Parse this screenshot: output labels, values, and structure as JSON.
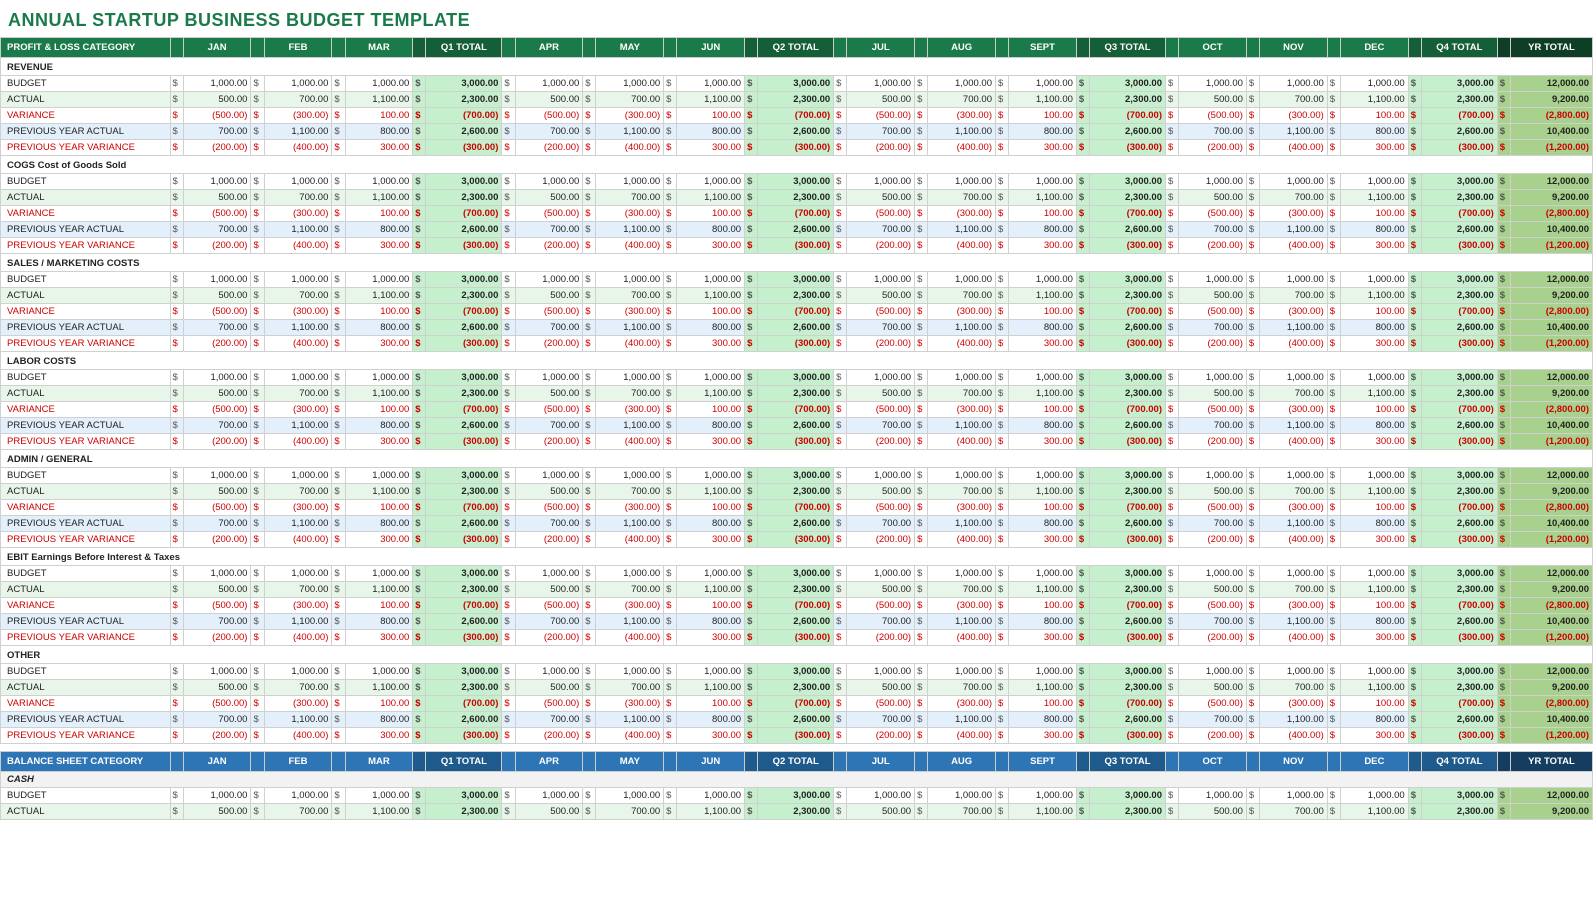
{
  "title": "ANNUAL STARTUP BUSINESS BUDGET TEMPLATE",
  "columns": {
    "label": "PROFIT & LOSS CATEGORY",
    "months": [
      "JAN",
      "FEB",
      "MAR",
      "APR",
      "MAY",
      "JUN",
      "JUL",
      "AUG",
      "SEPT",
      "OCT",
      "NOV",
      "DEC"
    ],
    "q_totals": [
      "Q1 TOTAL",
      "Q2 TOTAL",
      "Q3 TOTAL",
      "Q4 TOTAL"
    ],
    "yr_total": "YR TOTAL"
  },
  "balance_columns": {
    "label": "BALANCE SHEET CATEGORY"
  },
  "sections": [
    {
      "name": "REVENUE",
      "rows": [
        {
          "label": "BUDGET",
          "type": "budget",
          "values": [
            1000,
            1000,
            1000,
            3000,
            1000,
            1000,
            1000,
            3000,
            1000,
            1000,
            1000,
            3000,
            1000,
            1000,
            1000,
            3000,
            12000
          ]
        },
        {
          "label": "ACTUAL",
          "type": "actual",
          "values": [
            500,
            700,
            1100,
            2300,
            500,
            700,
            1100,
            2300,
            500,
            700,
            1100,
            2300,
            500,
            700,
            1100,
            2300,
            9200
          ]
        },
        {
          "label": "VARIANCE",
          "type": "variance",
          "values": [
            -500,
            -300,
            100,
            -700,
            -500,
            -300,
            100,
            -700,
            -500,
            -300,
            100,
            -700,
            -500,
            -300,
            100,
            -700,
            -2800
          ]
        },
        {
          "label": "PREVIOUS YEAR ACTUAL",
          "type": "py-actual",
          "values": [
            700,
            1100,
            800,
            2600,
            700,
            1100,
            800,
            2600,
            700,
            1100,
            800,
            2600,
            700,
            1100,
            800,
            2600,
            10400
          ]
        },
        {
          "label": "PREVIOUS YEAR VARIANCE",
          "type": "py-variance",
          "values": [
            -200,
            -400,
            300,
            -300,
            -200,
            -400,
            300,
            -300,
            -200,
            -400,
            300,
            -300,
            -200,
            -400,
            300,
            -300,
            -1200
          ]
        }
      ]
    },
    {
      "name": "COGS Cost of Goods Sold",
      "rows": [
        {
          "label": "BUDGET",
          "type": "budget",
          "values": [
            1000,
            1000,
            1000,
            3000,
            1000,
            1000,
            1000,
            3000,
            1000,
            1000,
            1000,
            3000,
            1000,
            1000,
            1000,
            3000,
            12000
          ]
        },
        {
          "label": "ACTUAL",
          "type": "actual",
          "values": [
            500,
            700,
            1100,
            2300,
            500,
            700,
            1100,
            2300,
            500,
            700,
            1100,
            2300,
            500,
            700,
            1100,
            2300,
            9200
          ]
        },
        {
          "label": "VARIANCE",
          "type": "variance",
          "values": [
            -500,
            -300,
            100,
            -700,
            -500,
            -300,
            100,
            -700,
            -500,
            -300,
            100,
            -700,
            -500,
            -300,
            100,
            -700,
            -2800
          ]
        },
        {
          "label": "PREVIOUS YEAR ACTUAL",
          "type": "py-actual",
          "values": [
            700,
            1100,
            800,
            2600,
            700,
            1100,
            800,
            2600,
            700,
            1100,
            800,
            2600,
            700,
            1100,
            800,
            2600,
            10400
          ]
        },
        {
          "label": "PREVIOUS YEAR VARIANCE",
          "type": "py-variance",
          "values": [
            -200,
            -400,
            300,
            -300,
            -200,
            -400,
            300,
            -300,
            -200,
            -400,
            300,
            -300,
            -200,
            -400,
            300,
            -300,
            -1200
          ]
        }
      ]
    },
    {
      "name": "SALES / MARKETING COSTS",
      "rows": [
        {
          "label": "BUDGET",
          "type": "budget",
          "values": [
            1000,
            1000,
            1000,
            3000,
            1000,
            1000,
            1000,
            3000,
            1000,
            1000,
            1000,
            3000,
            1000,
            1000,
            1000,
            3000,
            12000
          ]
        },
        {
          "label": "ACTUAL",
          "type": "actual",
          "values": [
            500,
            700,
            1100,
            2300,
            500,
            700,
            1100,
            2300,
            500,
            700,
            1100,
            2300,
            500,
            700,
            1100,
            2300,
            9200
          ]
        },
        {
          "label": "VARIANCE",
          "type": "variance",
          "values": [
            -500,
            -300,
            100,
            -700,
            -500,
            -300,
            100,
            -700,
            -500,
            -300,
            100,
            -700,
            -500,
            -300,
            100,
            -700,
            -2800
          ]
        },
        {
          "label": "PREVIOUS YEAR ACTUAL",
          "type": "py-actual",
          "values": [
            700,
            1100,
            800,
            2600,
            700,
            1100,
            800,
            2600,
            700,
            1100,
            800,
            2600,
            700,
            1100,
            800,
            2600,
            10400
          ]
        },
        {
          "label": "PREVIOUS YEAR VARIANCE",
          "type": "py-variance",
          "values": [
            -200,
            -400,
            300,
            -300,
            -200,
            -400,
            300,
            -300,
            -200,
            -400,
            300,
            -300,
            -200,
            -400,
            300,
            -300,
            -1200
          ]
        }
      ]
    },
    {
      "name": "LABOR COSTS",
      "rows": [
        {
          "label": "BUDGET",
          "type": "budget",
          "values": [
            1000,
            1000,
            1000,
            3000,
            1000,
            1000,
            1000,
            3000,
            1000,
            1000,
            1000,
            3000,
            1000,
            1000,
            1000,
            3000,
            12000
          ]
        },
        {
          "label": "ACTUAL",
          "type": "actual",
          "values": [
            500,
            700,
            1100,
            2300,
            500,
            700,
            1100,
            2300,
            500,
            700,
            1100,
            2300,
            500,
            700,
            1100,
            2300,
            9200
          ]
        },
        {
          "label": "VARIANCE",
          "type": "variance",
          "values": [
            -500,
            -300,
            100,
            -700,
            -500,
            -300,
            100,
            -700,
            -500,
            -300,
            100,
            -700,
            -500,
            -300,
            100,
            -700,
            -2800
          ]
        },
        {
          "label": "PREVIOUS YEAR ACTUAL",
          "type": "py-actual",
          "values": [
            700,
            1100,
            800,
            2600,
            700,
            1100,
            800,
            2600,
            700,
            1100,
            800,
            2600,
            700,
            1100,
            800,
            2600,
            10400
          ]
        },
        {
          "label": "PREVIOUS YEAR VARIANCE",
          "type": "py-variance",
          "values": [
            -200,
            -400,
            300,
            -300,
            -200,
            -400,
            300,
            -300,
            -200,
            -400,
            300,
            -300,
            -200,
            -400,
            300,
            -300,
            -1200
          ]
        }
      ]
    },
    {
      "name": "ADMIN / GENERAL",
      "rows": [
        {
          "label": "BUDGET",
          "type": "budget",
          "values": [
            1000,
            1000,
            1000,
            3000,
            1000,
            1000,
            1000,
            3000,
            1000,
            1000,
            1000,
            3000,
            1000,
            1000,
            1000,
            3000,
            12000
          ]
        },
        {
          "label": "ACTUAL",
          "type": "actual",
          "values": [
            500,
            700,
            1100,
            2300,
            500,
            700,
            1100,
            2300,
            500,
            700,
            1100,
            2300,
            500,
            700,
            1100,
            2300,
            9200
          ]
        },
        {
          "label": "VARIANCE",
          "type": "variance",
          "values": [
            -500,
            -300,
            100,
            -700,
            -500,
            -300,
            100,
            -700,
            -500,
            -300,
            100,
            -700,
            -500,
            -300,
            100,
            -700,
            -2800
          ]
        },
        {
          "label": "PREVIOUS YEAR ACTUAL",
          "type": "py-actual",
          "values": [
            700,
            1100,
            800,
            2600,
            700,
            1100,
            800,
            2600,
            700,
            1100,
            800,
            2600,
            700,
            1100,
            800,
            2600,
            10400
          ]
        },
        {
          "label": "PREVIOUS YEAR VARIANCE",
          "type": "py-variance",
          "values": [
            -200,
            -400,
            300,
            -300,
            -200,
            -400,
            300,
            -300,
            -200,
            -400,
            300,
            -300,
            -200,
            -400,
            300,
            -300,
            -1200
          ]
        }
      ]
    },
    {
      "name": "EBIT Earnings Before Interest & Taxes",
      "rows": [
        {
          "label": "BUDGET",
          "type": "budget",
          "values": [
            1000,
            1000,
            1000,
            3000,
            1000,
            1000,
            1000,
            3000,
            1000,
            1000,
            1000,
            3000,
            1000,
            1000,
            1000,
            3000,
            12000
          ]
        },
        {
          "label": "ACTUAL",
          "type": "actual",
          "values": [
            500,
            700,
            1100,
            2300,
            500,
            700,
            1100,
            2300,
            500,
            700,
            1100,
            2300,
            500,
            700,
            1100,
            2300,
            9200
          ]
        },
        {
          "label": "VARIANCE",
          "type": "variance",
          "values": [
            -500,
            -300,
            100,
            -700,
            -500,
            -300,
            100,
            -700,
            -500,
            -300,
            100,
            -700,
            -500,
            -300,
            100,
            -700,
            -2800
          ]
        },
        {
          "label": "PREVIOUS YEAR ACTUAL",
          "type": "py-actual",
          "values": [
            700,
            1100,
            800,
            2600,
            700,
            1100,
            800,
            2600,
            700,
            1100,
            800,
            2600,
            700,
            1100,
            800,
            2600,
            10400
          ]
        },
        {
          "label": "PREVIOUS YEAR VARIANCE",
          "type": "py-variance",
          "values": [
            -200,
            -400,
            300,
            -300,
            -200,
            -400,
            300,
            -300,
            -200,
            -400,
            300,
            -300,
            -200,
            -400,
            300,
            -300,
            -1200
          ]
        }
      ]
    },
    {
      "name": "OTHER",
      "rows": [
        {
          "label": "BUDGET",
          "type": "budget",
          "values": [
            1000,
            1000,
            1000,
            3000,
            1000,
            1000,
            1000,
            3000,
            1000,
            1000,
            1000,
            3000,
            1000,
            1000,
            1000,
            3000,
            12000
          ]
        },
        {
          "label": "ACTUAL",
          "type": "actual",
          "values": [
            500,
            700,
            1100,
            2300,
            500,
            700,
            1100,
            2300,
            500,
            700,
            1100,
            2300,
            500,
            700,
            1100,
            2300,
            9200
          ]
        },
        {
          "label": "VARIANCE",
          "type": "variance",
          "values": [
            -500,
            -300,
            100,
            -700,
            -500,
            -300,
            100,
            -700,
            -500,
            -300,
            100,
            -700,
            -500,
            -300,
            100,
            -700,
            -2800
          ]
        },
        {
          "label": "PREVIOUS YEAR ACTUAL",
          "type": "py-actual",
          "values": [
            700,
            1100,
            800,
            2600,
            700,
            1100,
            800,
            2600,
            700,
            1100,
            800,
            2600,
            700,
            1100,
            800,
            2600,
            10400
          ]
        },
        {
          "label": "PREVIOUS YEAR VARIANCE",
          "type": "py-variance",
          "values": [
            -200,
            -400,
            300,
            -300,
            -200,
            -400,
            300,
            -300,
            -200,
            -400,
            300,
            -300,
            -200,
            -400,
            300,
            -300,
            -1200
          ]
        }
      ]
    }
  ],
  "balance_sections": [
    {
      "name": "CASH",
      "rows": [
        {
          "label": "BUDGET",
          "type": "budget",
          "values": [
            1000,
            1000,
            1000,
            3000,
            1000,
            1000,
            1000,
            3000,
            1000,
            1000,
            1000,
            3000,
            1000,
            1000,
            1000,
            3000,
            12000
          ]
        },
        {
          "label": "ACTUAL",
          "type": "actual",
          "values": [
            500,
            700,
            1100,
            2300,
            500,
            700,
            1100,
            2300,
            500,
            700,
            1100,
            2300,
            500,
            700,
            1100,
            2300,
            9200
          ]
        }
      ]
    }
  ]
}
